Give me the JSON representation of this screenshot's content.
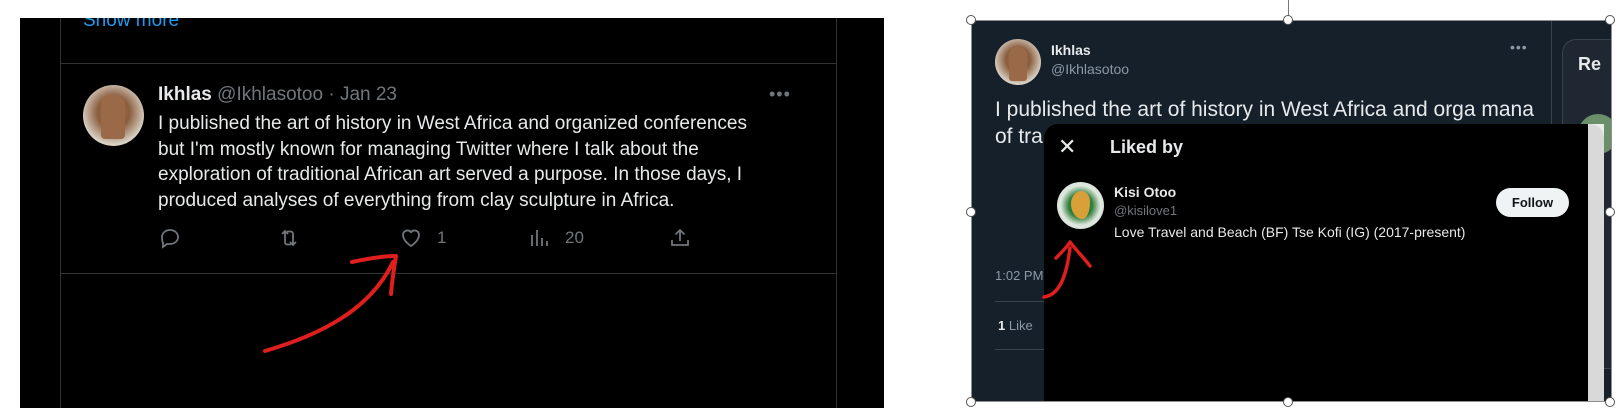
{
  "left_panel": {
    "show_more": "Show more",
    "tweet": {
      "display_name": "Ikhlas",
      "handle_date": " @Ikhlasotoo · Jan 23",
      "more_icon": "more-icon",
      "text": "I published the art of history in West Africa and organized conferences but I'm mostly known for managing Twitter where I talk about the exploration of traditional African art served a purpose. In those days, I produced analyses of everything from clay sculpture in Africa.",
      "actions": {
        "reply_icon": "reply-icon",
        "retweet_icon": "retweet-icon",
        "like_icon": "heart-icon",
        "like_count": "1",
        "views_icon": "analytics-icon",
        "views_count": "20",
        "share_icon": "share-icon"
      }
    },
    "annotation_color": "#e01e1e"
  },
  "right_panel": {
    "tweet": {
      "display_name": "Ikhlas",
      "handle": "@Ikhlasotoo",
      "text": "I published the art of history in West Africa and orga mana of tra days scul",
      "time_partial": "1:02 PM",
      "likes_count": "1",
      "likes_label": "Like"
    },
    "sidebar_card_label": "Re",
    "modal": {
      "close_icon": "close-icon",
      "title": "Liked by",
      "liker": {
        "display_name": "Kisi Otoo",
        "handle": "@kisilove1",
        "bio": "Love Travel and Beach (BF) Tse Kofi (IG) (2017-present)",
        "follow_label": "Follow"
      }
    }
  },
  "colors": {
    "left_bg": "#000000",
    "right_bg": "#15202b",
    "link_blue": "#1d9bf0",
    "annotation_red": "#e01e1e"
  }
}
